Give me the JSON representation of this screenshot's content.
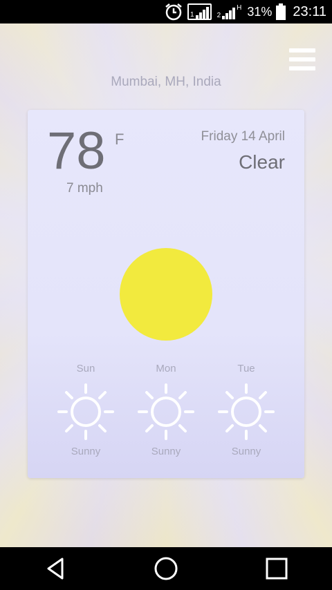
{
  "status_bar": {
    "battery": "31%",
    "time": "23:11",
    "net_type": "H"
  },
  "header": {
    "location": "Mumbai, MH, India"
  },
  "current": {
    "temperature": "78",
    "unit": "F",
    "wind": "7 mph",
    "date": "Friday 14 April",
    "condition": "Clear"
  },
  "forecast": [
    {
      "day": "Sun",
      "condition": "Sunny",
      "icon": "sun-outline-icon"
    },
    {
      "day": "Mon",
      "condition": "Sunny",
      "icon": "sun-outline-icon"
    },
    {
      "day": "Tue",
      "condition": "Sunny",
      "icon": "sun-outline-icon"
    }
  ],
  "colors": {
    "sun": "#f2ea3e",
    "card": "#e6e6fa",
    "text": "#6e6e76"
  }
}
